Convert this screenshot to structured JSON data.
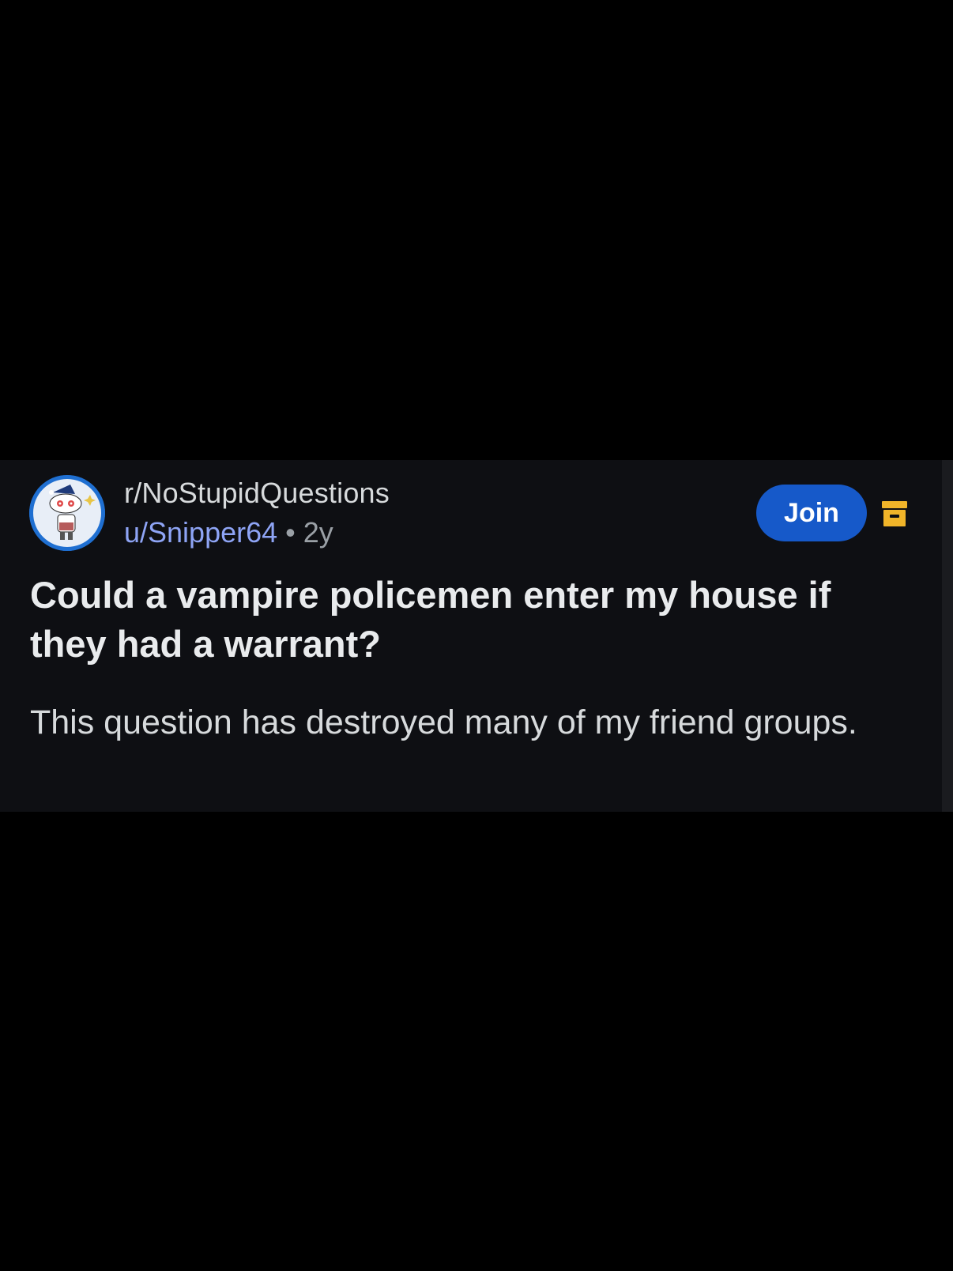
{
  "post": {
    "subreddit": "r/NoStupidQuestions",
    "username": "u/Snipper64",
    "separator": "•",
    "age": "2y",
    "join_label": "Join",
    "title": "Could a vampire policemen enter my house if they had a warrant?",
    "body": "This question has destroyed many of my friend groups."
  },
  "icons": {
    "avatar": "snoo-avatar-icon",
    "archive": "archive-icon"
  },
  "colors": {
    "background": "#000000",
    "card": "#0e0f13",
    "join_button": "#1659c9",
    "username": "#8ea4f5",
    "archive_icon": "#f0b429"
  }
}
